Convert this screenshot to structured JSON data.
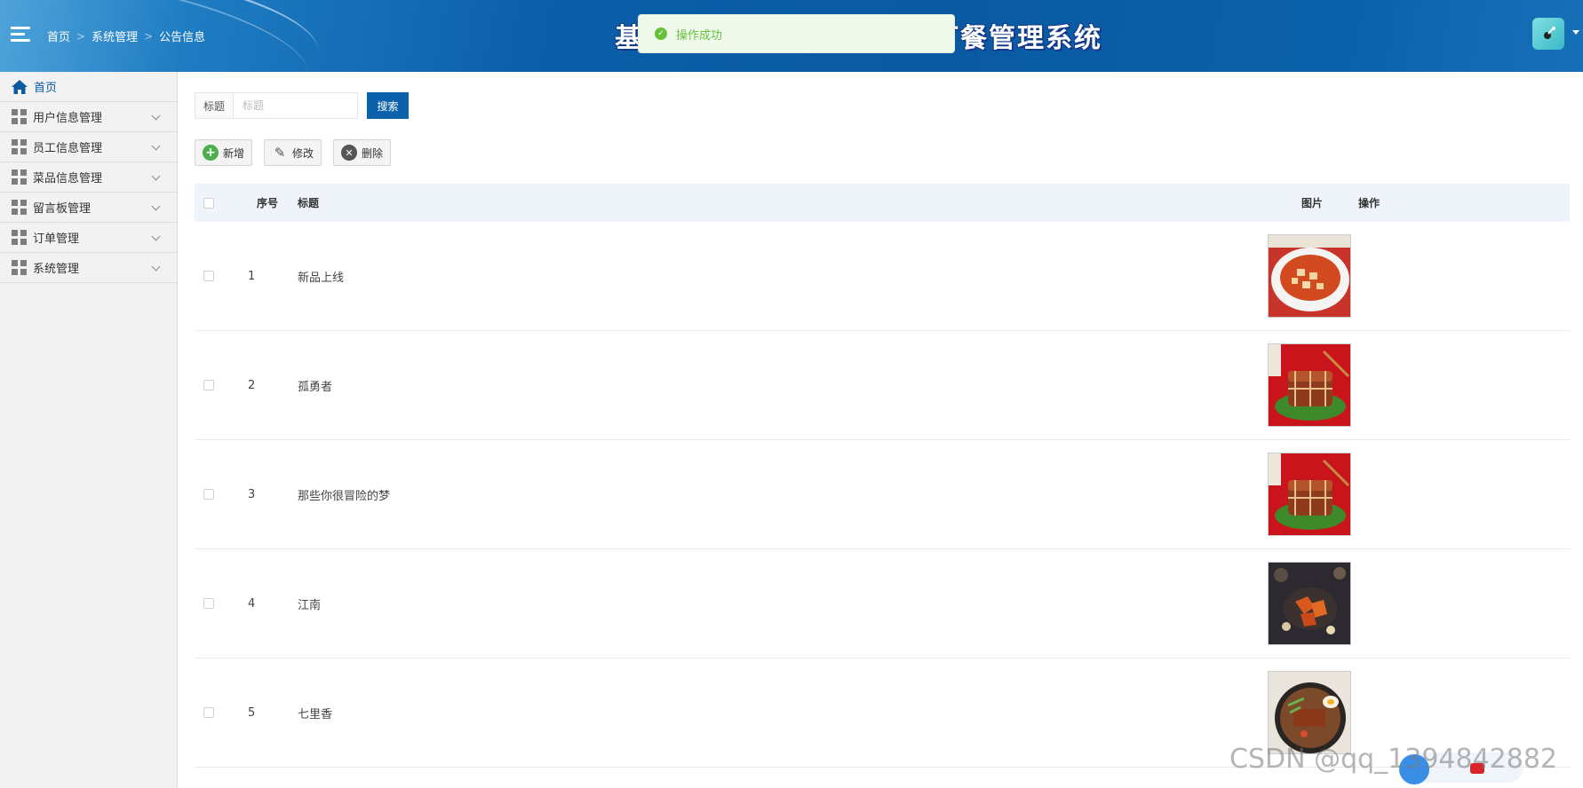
{
  "header": {
    "breadcrumb": [
      "首页",
      "系统管理",
      "公告信息"
    ],
    "title": "基于...订餐管理系统",
    "title_left": "基",
    "title_right": "订餐管理系统"
  },
  "toast": {
    "message": "操作成功",
    "type": "success"
  },
  "sidebar": {
    "items": [
      {
        "label": "首页",
        "icon": "home-icon",
        "active": true
      },
      {
        "label": "用户信息管理",
        "icon": "grid-icon"
      },
      {
        "label": "员工信息管理",
        "icon": "grid-icon"
      },
      {
        "label": "菜品信息管理",
        "icon": "grid-icon"
      },
      {
        "label": "留言板管理",
        "icon": "grid-icon"
      },
      {
        "label": "订单管理",
        "icon": "grid-icon"
      },
      {
        "label": "系统管理",
        "icon": "grid-icon"
      }
    ]
  },
  "search": {
    "label": "标题",
    "placeholder": "标题",
    "value": "",
    "button": "搜索"
  },
  "toolbar": {
    "add": "新增",
    "edit": "修改",
    "delete": "删除"
  },
  "table": {
    "columns": {
      "no": "序号",
      "title": "标题",
      "image": "图片",
      "action": "操作"
    },
    "rows": [
      {
        "no": "1",
        "title": "新品上线",
        "image": "dish-mapo-tofu"
      },
      {
        "no": "2",
        "title": "孤勇者",
        "image": "dish-braised-pork"
      },
      {
        "no": "3",
        "title": "那些你很冒险的梦",
        "image": "dish-braised-pork"
      },
      {
        "no": "4",
        "title": "江南",
        "image": "dish-stir-fry"
      },
      {
        "no": "5",
        "title": "七里香",
        "image": "dish-noodle-bowl"
      }
    ]
  },
  "watermark": "CSDN @qq_1394842882",
  "colors": {
    "primary": "#0b62aa",
    "success": "#67c23a",
    "header": "#0a5aa2"
  }
}
